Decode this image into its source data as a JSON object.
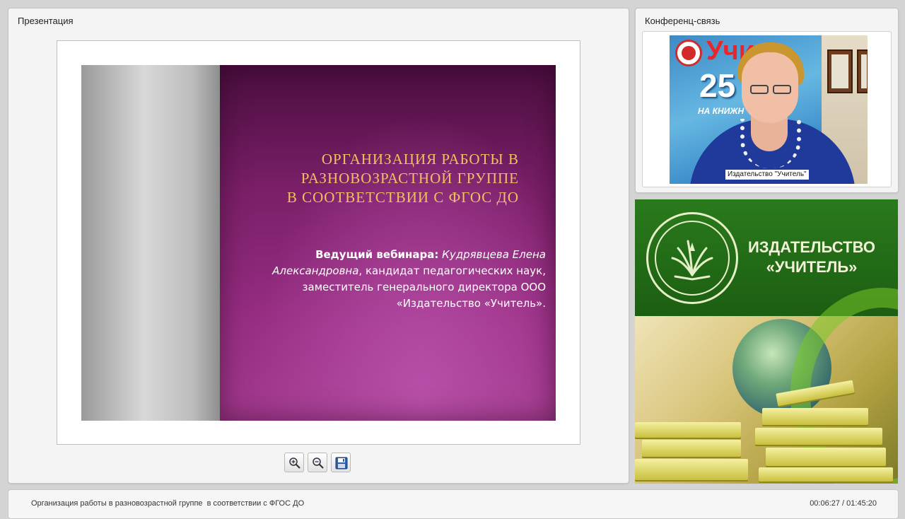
{
  "presentation": {
    "title": "Презентация",
    "slide": {
      "heading_lines": [
        "Организация работы в",
        "разновозрастной группе",
        "в соответствии с ФГОС ДО"
      ],
      "host_label": "Ведущий вебинара:",
      "host_name_first": " Кудрявцева Елена",
      "host_name_second": "Александровна",
      "host_rest_line2": ", кандидат педагогических наук,",
      "line3": "заместитель генерального директора ООО",
      "line4": "«Издательство «Учитель»."
    },
    "toolbar": {
      "zoom_in_icon": "zoom-in-icon",
      "zoom_out_icon": "zoom-out-icon",
      "save_icon": "floppy-disk-icon"
    }
  },
  "conference": {
    "title": "Конференц-связь",
    "video_caption": "Издательство \"Учитель\"",
    "poster": {
      "brand": "Учи",
      "number": "25",
      "subtitle": "НА КНИЖН"
    }
  },
  "banner": {
    "line1": "ИЗДАТЕЛЬСТВО",
    "line2": "«УЧИТЕЛЬ»",
    "colors": {
      "green": "#1f6414",
      "text": "#f2f2d8"
    }
  },
  "footer": {
    "title": "Организация работы в разновозрастной группе  в соответствии с ФГОС ДО",
    "time": "00:06:27 / 01:45:20"
  },
  "colors": {
    "slide_heading": "#f2c063",
    "slide_bg": "#8a2678"
  }
}
